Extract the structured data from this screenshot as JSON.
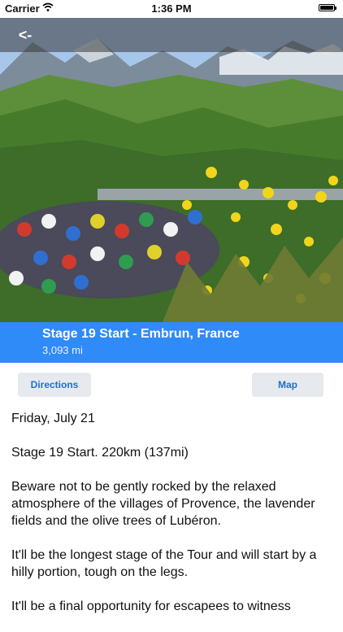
{
  "status": {
    "carrier": "Carrier",
    "time": "1:36 PM"
  },
  "nav": {
    "back_label": "<-"
  },
  "banner": {
    "title": "Stage 19 Start - Embrun, France",
    "distance": "3,093 mi"
  },
  "actions": {
    "directions": "Directions",
    "map": "Map"
  },
  "content": {
    "date": "Friday, July 21",
    "stage": "Stage 19 Start. 220km (137mi)",
    "p1": "Beware not to be gently rocked by the relaxed atmosphere of the villages of Provence, the lavender fields and the olive trees of Lubéron.",
    "p2": "It'll be the longest stage of the Tour and will start by a hilly portion, tough on the legs.",
    "p3": "It'll be a final opportunity for escapees to witness"
  },
  "colors": {
    "banner": "#2f8bf7",
    "button_bg": "#e6eaee",
    "button_text": "#1f6fd1"
  }
}
